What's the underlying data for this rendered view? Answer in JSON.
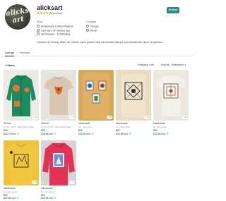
{
  "shop": {
    "avatar_text": "alicks art",
    "name": "alicksart",
    "stars": "★★★★★",
    "reviews": "8 reviews",
    "follow_label": "Follow"
  },
  "about": {
    "left_heading": "Shop",
    "right_heading": "Contacts",
    "left_rows": [
      "Brownhead, United Kingdom",
      "Last seen 39 minutes ago",
      "16 followers · 19 following"
    ],
    "right_rows": [
      "Google",
      "Email"
    ],
    "bio": "Linoprint & Sewing artist. All clothes hand printed with handmade stamps and handmade sewn on patches"
  },
  "tabs": [
    {
      "label": "Listings"
    },
    {
      "label": "Reviews"
    }
  ],
  "toolbar": {
    "count": "7 items",
    "category_label": "Category",
    "category_value": "All",
    "sort_label": "Sort by",
    "sort_value": "Relevance"
  },
  "listings": [
    {
      "title": "Printed",
      "sub": "M / 12-14 Y8 · New without tags",
      "price": "$40",
      "old": "",
      "sale": "$44.79 incl. ©",
      "likes": "♡ 0",
      "image": "green-hoodie-orange-patches"
    },
    {
      "title": "Vibrant",
      "sub": "M / 12-14 Y8 · New without tags",
      "price": "$25",
      "old": "",
      "sale": "$26.66 incl. ©",
      "likes": "♡ 0",
      "image": "beige-tee-orange-print"
    },
    {
      "title": "Handmade",
      "sub": "XL · Very good",
      "price": "$22",
      "old": "",
      "sale": "$23.96 incl. ©",
      "likes": "♡ 0",
      "image": "mustard-tee-blue-patches"
    },
    {
      "title": "Handmade",
      "sub": "XL · Very good",
      "price": "$22",
      "old": "",
      "sale": "$23.96 incl. ©",
      "likes": "♡ 0",
      "image": "cream-tee-black-print"
    },
    {
      "title": "Handmade",
      "sub": "M · Very good",
      "price": "$22",
      "old": "",
      "sale": "$23.96 incl. ©",
      "likes": "♡ 0",
      "image": "white-tee-brown-print"
    },
    {
      "title": "Handmade",
      "sub": "M · Very good",
      "price": "$22",
      "old": "",
      "sale": "$23.96 incl. ©",
      "likes": "♡ 0",
      "image": "yellow-sweatshirt-print"
    },
    {
      "title": "Handmade",
      "sub": "M · Very good",
      "price": "$22",
      "old": "",
      "sale": "$23.96 incl. ©",
      "likes": "♡ 1",
      "image": "pink-hoodie-print"
    }
  ],
  "colors": {
    "accent": "#2d8c86",
    "star": "#e0a000"
  }
}
